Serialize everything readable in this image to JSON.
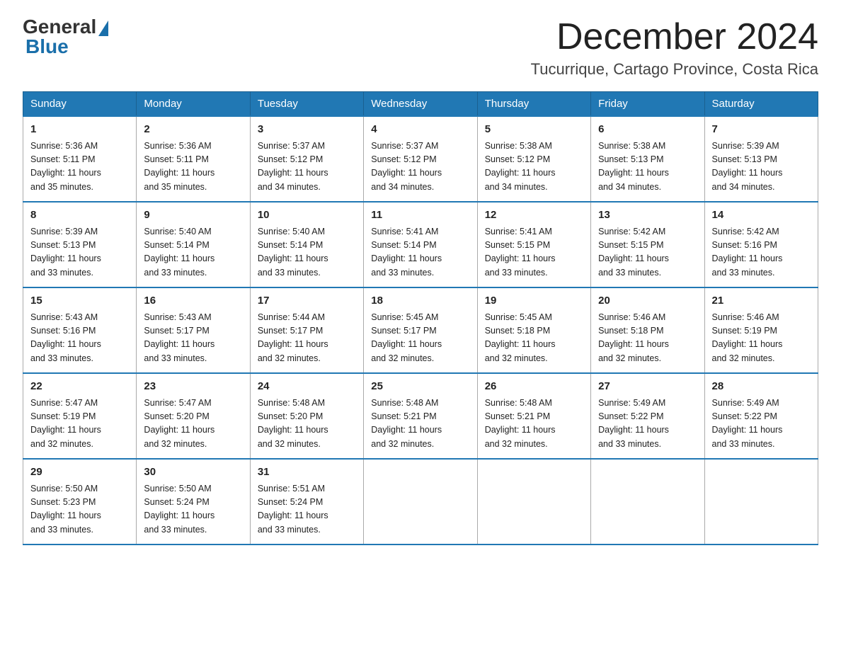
{
  "header": {
    "logo_general": "General",
    "logo_blue": "Blue",
    "month_title": "December 2024",
    "subtitle": "Tucurrique, Cartago Province, Costa Rica"
  },
  "weekdays": [
    "Sunday",
    "Monday",
    "Tuesday",
    "Wednesday",
    "Thursday",
    "Friday",
    "Saturday"
  ],
  "weeks": [
    [
      {
        "day": "1",
        "sunrise": "5:36 AM",
        "sunset": "5:11 PM",
        "daylight": "11 hours and 35 minutes."
      },
      {
        "day": "2",
        "sunrise": "5:36 AM",
        "sunset": "5:11 PM",
        "daylight": "11 hours and 35 minutes."
      },
      {
        "day": "3",
        "sunrise": "5:37 AM",
        "sunset": "5:12 PM",
        "daylight": "11 hours and 34 minutes."
      },
      {
        "day": "4",
        "sunrise": "5:37 AM",
        "sunset": "5:12 PM",
        "daylight": "11 hours and 34 minutes."
      },
      {
        "day": "5",
        "sunrise": "5:38 AM",
        "sunset": "5:12 PM",
        "daylight": "11 hours and 34 minutes."
      },
      {
        "day": "6",
        "sunrise": "5:38 AM",
        "sunset": "5:13 PM",
        "daylight": "11 hours and 34 minutes."
      },
      {
        "day": "7",
        "sunrise": "5:39 AM",
        "sunset": "5:13 PM",
        "daylight": "11 hours and 34 minutes."
      }
    ],
    [
      {
        "day": "8",
        "sunrise": "5:39 AM",
        "sunset": "5:13 PM",
        "daylight": "11 hours and 33 minutes."
      },
      {
        "day": "9",
        "sunrise": "5:40 AM",
        "sunset": "5:14 PM",
        "daylight": "11 hours and 33 minutes."
      },
      {
        "day": "10",
        "sunrise": "5:40 AM",
        "sunset": "5:14 PM",
        "daylight": "11 hours and 33 minutes."
      },
      {
        "day": "11",
        "sunrise": "5:41 AM",
        "sunset": "5:14 PM",
        "daylight": "11 hours and 33 minutes."
      },
      {
        "day": "12",
        "sunrise": "5:41 AM",
        "sunset": "5:15 PM",
        "daylight": "11 hours and 33 minutes."
      },
      {
        "day": "13",
        "sunrise": "5:42 AM",
        "sunset": "5:15 PM",
        "daylight": "11 hours and 33 minutes."
      },
      {
        "day": "14",
        "sunrise": "5:42 AM",
        "sunset": "5:16 PM",
        "daylight": "11 hours and 33 minutes."
      }
    ],
    [
      {
        "day": "15",
        "sunrise": "5:43 AM",
        "sunset": "5:16 PM",
        "daylight": "11 hours and 33 minutes."
      },
      {
        "day": "16",
        "sunrise": "5:43 AM",
        "sunset": "5:17 PM",
        "daylight": "11 hours and 33 minutes."
      },
      {
        "day": "17",
        "sunrise": "5:44 AM",
        "sunset": "5:17 PM",
        "daylight": "11 hours and 32 minutes."
      },
      {
        "day": "18",
        "sunrise": "5:45 AM",
        "sunset": "5:17 PM",
        "daylight": "11 hours and 32 minutes."
      },
      {
        "day": "19",
        "sunrise": "5:45 AM",
        "sunset": "5:18 PM",
        "daylight": "11 hours and 32 minutes."
      },
      {
        "day": "20",
        "sunrise": "5:46 AM",
        "sunset": "5:18 PM",
        "daylight": "11 hours and 32 minutes."
      },
      {
        "day": "21",
        "sunrise": "5:46 AM",
        "sunset": "5:19 PM",
        "daylight": "11 hours and 32 minutes."
      }
    ],
    [
      {
        "day": "22",
        "sunrise": "5:47 AM",
        "sunset": "5:19 PM",
        "daylight": "11 hours and 32 minutes."
      },
      {
        "day": "23",
        "sunrise": "5:47 AM",
        "sunset": "5:20 PM",
        "daylight": "11 hours and 32 minutes."
      },
      {
        "day": "24",
        "sunrise": "5:48 AM",
        "sunset": "5:20 PM",
        "daylight": "11 hours and 32 minutes."
      },
      {
        "day": "25",
        "sunrise": "5:48 AM",
        "sunset": "5:21 PM",
        "daylight": "11 hours and 32 minutes."
      },
      {
        "day": "26",
        "sunrise": "5:48 AM",
        "sunset": "5:21 PM",
        "daylight": "11 hours and 32 minutes."
      },
      {
        "day": "27",
        "sunrise": "5:49 AM",
        "sunset": "5:22 PM",
        "daylight": "11 hours and 33 minutes."
      },
      {
        "day": "28",
        "sunrise": "5:49 AM",
        "sunset": "5:22 PM",
        "daylight": "11 hours and 33 minutes."
      }
    ],
    [
      {
        "day": "29",
        "sunrise": "5:50 AM",
        "sunset": "5:23 PM",
        "daylight": "11 hours and 33 minutes."
      },
      {
        "day": "30",
        "sunrise": "5:50 AM",
        "sunset": "5:24 PM",
        "daylight": "11 hours and 33 minutes."
      },
      {
        "day": "31",
        "sunrise": "5:51 AM",
        "sunset": "5:24 PM",
        "daylight": "11 hours and 33 minutes."
      },
      null,
      null,
      null,
      null
    ]
  ],
  "labels": {
    "sunrise": "Sunrise:",
    "sunset": "Sunset:",
    "daylight": "Daylight:"
  }
}
